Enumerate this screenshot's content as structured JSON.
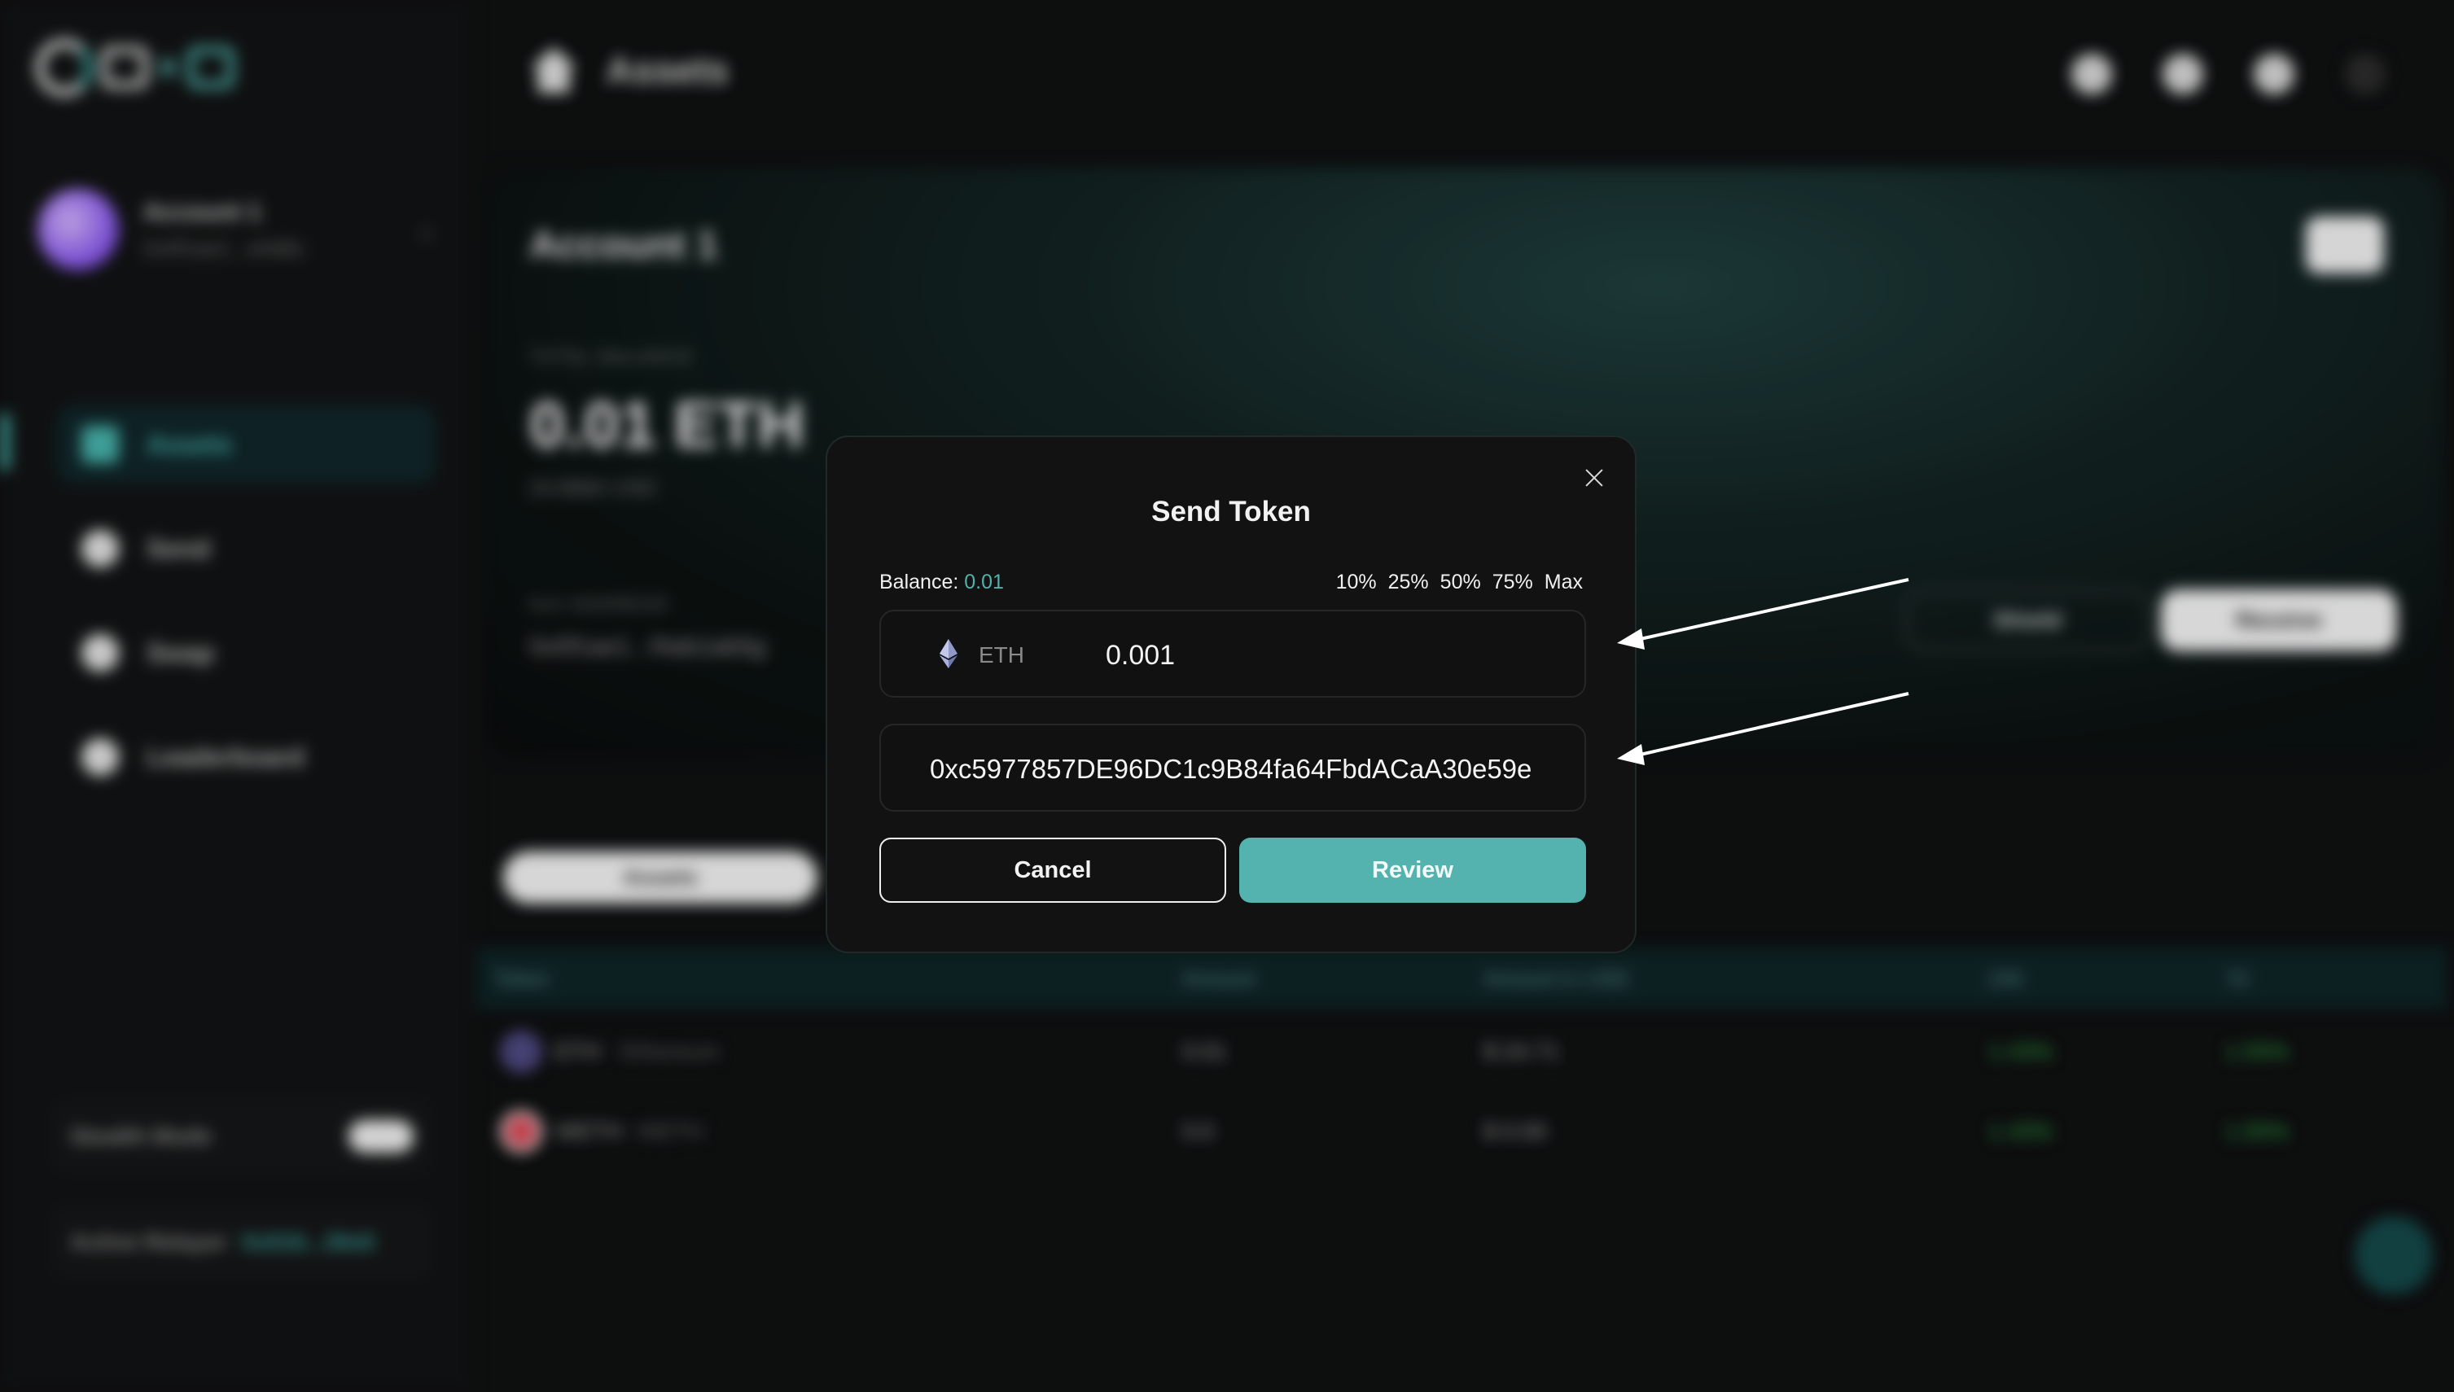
{
  "header": {
    "page_title": "Assets"
  },
  "sidebar": {
    "account_name": "Account 1",
    "account_address": "0x0f1ae1...e0d6c",
    "nav": [
      {
        "label": "Assets",
        "icon": "home-icon",
        "active": true
      },
      {
        "label": "Send",
        "icon": "send-icon",
        "active": false
      },
      {
        "label": "Swap",
        "icon": "swap-icon",
        "active": false
      },
      {
        "label": "Leaderboard",
        "icon": "trophy-icon",
        "active": false
      }
    ],
    "stealth_mode_label": "Stealth Mode",
    "active_relayer_label": "Active Relayer",
    "active_relayer_value": "0x016...30e5"
  },
  "hero": {
    "account_name": "Account 1",
    "total_balance_label": "TOTAL BALANCE",
    "balance": "0.01 ETH",
    "balance_usd": "24.8684 USD",
    "address_label": "0xX ADDRESS",
    "address": "0x0f1ae1...f4ab1ab5g",
    "shield_label": "Shield",
    "receive_label": "Receive"
  },
  "assets_tab_label": "Assets",
  "table": {
    "headers": [
      "Token",
      "Amount",
      "Amount in USD",
      "24h",
      "7d"
    ],
    "rows": [
      {
        "symbol": "ETH",
        "name": "Ethereum",
        "amount": "0.01",
        "usd": "$ 24.71",
        "d24": "1.43%",
        "d7": "1.55%"
      },
      {
        "symbol": "WETH",
        "name": "WETH",
        "amount": "0.0",
        "usd": "$ 0.00",
        "d24": "1.43%",
        "d7": "1.55%"
      }
    ]
  },
  "modal": {
    "title": "Send Token",
    "balance_label": "Balance:",
    "balance_value": "0.01",
    "percent_options": [
      "10%",
      "25%",
      "50%",
      "75%",
      "Max"
    ],
    "token_symbol": "ETH",
    "amount_value": "0.001",
    "recipient_value": "0xc5977857DE96DC1c9B84fa64FbdACaA30e59e",
    "cancel_label": "Cancel",
    "review_label": "Review"
  },
  "colors": {
    "accent": "#54b3ae",
    "background": "#0f1011",
    "modal_bg": "#121212"
  }
}
